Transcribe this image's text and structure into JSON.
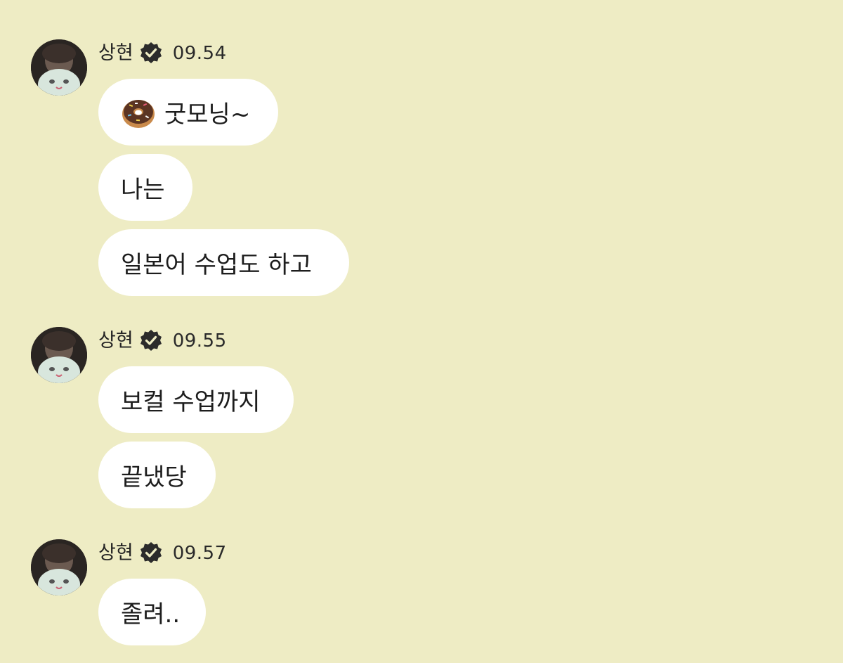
{
  "colors": {
    "background": "#eeecc4",
    "bubble": "#ffffff",
    "text": "#1d1d1d",
    "verified_badge": "#2b2b2b"
  },
  "groups": [
    {
      "sender": "상현",
      "time": "09.54",
      "messages": [
        {
          "text": "굿모닝~",
          "emoji": "donut-icon"
        },
        {
          "text": "나는"
        },
        {
          "text": "일본어 수업도 하고"
        }
      ]
    },
    {
      "sender": "상현",
      "time": "09.55",
      "messages": [
        {
          "text": "보컬 수업까지"
        },
        {
          "text": "끝냈당"
        }
      ]
    },
    {
      "sender": "상현",
      "time": "09.57",
      "messages": [
        {
          "text": "졸려.."
        }
      ]
    }
  ]
}
